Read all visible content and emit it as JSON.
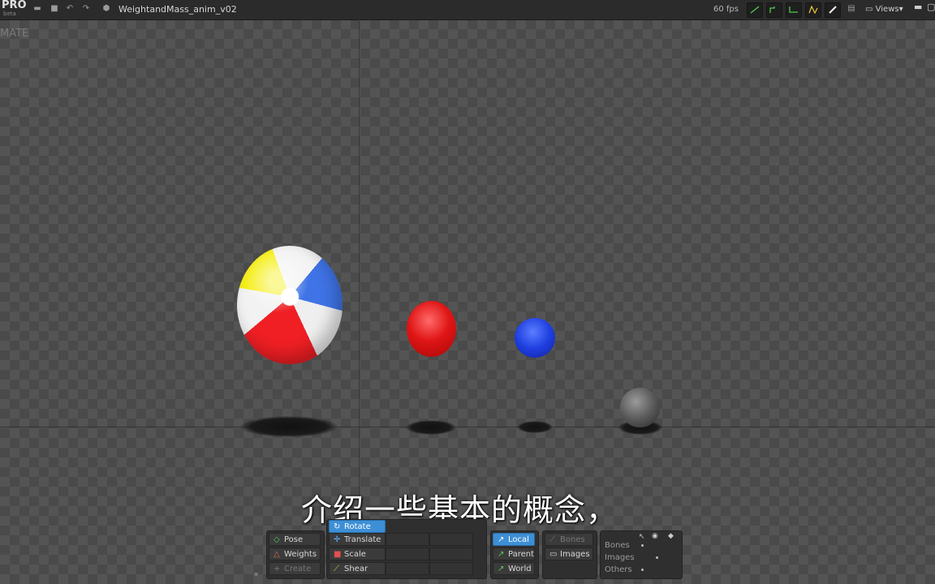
{
  "app": {
    "logo": "PRO",
    "logo_sub": "beta",
    "document_title": "WeightandMass_anim_v02",
    "fps": "60 fps",
    "views_label": "Views",
    "mode_label": "MATE"
  },
  "subtitle": "介绍一些基本的概念，",
  "toolbar": {
    "pose": "Pose",
    "weights": "Weights",
    "create": "Create",
    "rotate": "Rotate",
    "translate": "Translate",
    "scale": "Scale",
    "shear": "Shear",
    "local": "Local",
    "parent": "Parent",
    "world": "World",
    "bones": "Bones",
    "images": "Images"
  },
  "visibility": {
    "rows": [
      "Bones",
      "Images",
      "Others"
    ]
  },
  "colors": {
    "accent": "#3d8fd6",
    "beach_red": "#ef1f24",
    "beach_blue": "#3f73e6",
    "beach_yellow": "#f5ef1a"
  }
}
